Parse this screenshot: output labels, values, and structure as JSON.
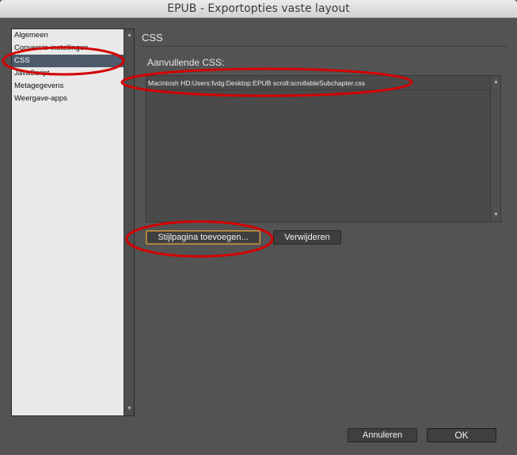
{
  "window": {
    "title": "EPUB - Exportopties vaste layout"
  },
  "sidebar": {
    "items": [
      {
        "label": "Algemeen"
      },
      {
        "label": "Conversie-instellingen"
      },
      {
        "label": "CSS",
        "selected": true
      },
      {
        "label": "JavaScript"
      },
      {
        "label": "Metagegevens"
      },
      {
        "label": "Weergave-apps"
      }
    ]
  },
  "main": {
    "section_title": "CSS",
    "field_label": "Aanvullende CSS:",
    "css_files": [
      "Macintosh HD:Users:fvdg:Desktop:EPUB scroll:scrollableSubchapter.css"
    ],
    "add_button": "Stijlpagina toevoegen...",
    "remove_button": "Verwijderen"
  },
  "footer": {
    "cancel_button": "Annuleren",
    "ok_button": "OK"
  },
  "colors": {
    "annotation": "#d40000",
    "selection": "#4d5a6b",
    "focus": "#d39c48"
  },
  "icons": [
    "scroll-up-arrow-icon",
    "scroll-down-arrow-icon"
  ]
}
